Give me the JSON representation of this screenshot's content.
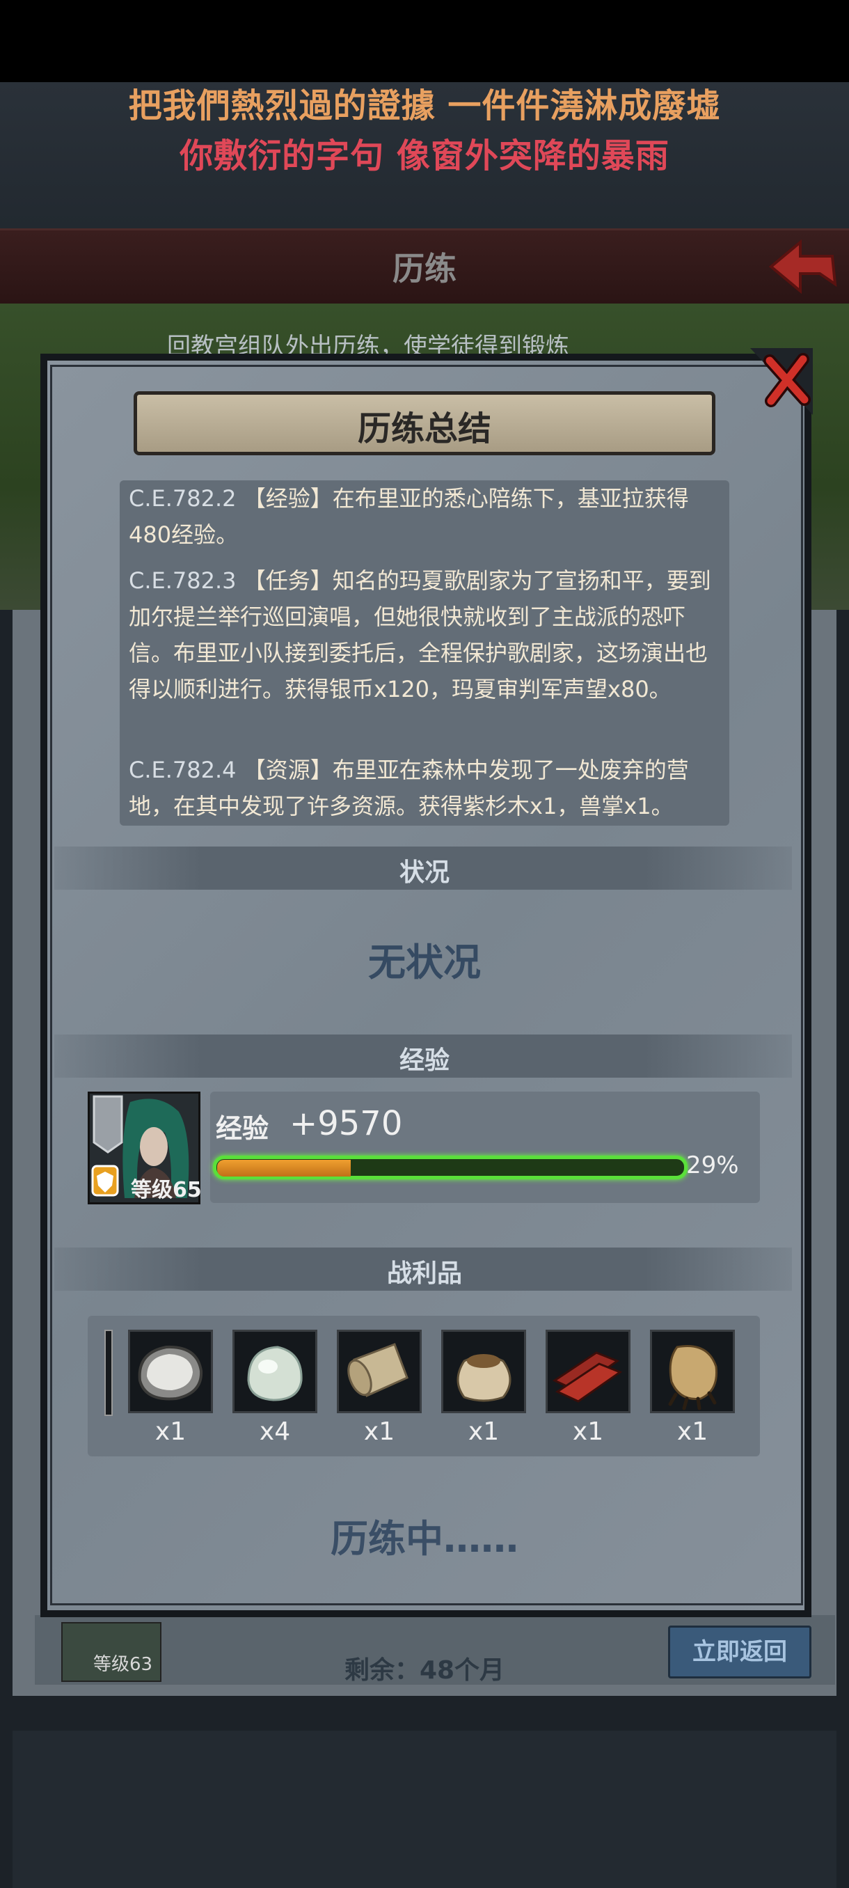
{
  "lyrics": {
    "line1": "把我們熱烈過的證據 一件件澆淋成廢墟",
    "line2": "你敷衍的字句 像窗外突降的暴雨"
  },
  "header": {
    "title": "历练"
  },
  "background": {
    "scene_text": "回教宫组队外出历练，使学徒得到锻炼",
    "level": "等级63",
    "remaining": "剩余：48个月",
    "return_button": "立即返回"
  },
  "dialog": {
    "title": "历练总结",
    "log": [
      {
        "date": "C.E.782.2",
        "text": "【经验】在布里亚的悉心陪练下，基亚拉获得480经验。"
      },
      {
        "date": "C.E.782.3",
        "text": "【任务】知名的玛夏歌剧家为了宣扬和平，要到加尔提兰举行巡回演唱，但她很快就收到了主战派的恐吓信。布里亚小队接到委托后，全程保护歌剧家，这场演出也得以顺利进行。获得银币x120，玛夏审判军声望x80。"
      },
      {
        "date": "C.E.782.4",
        "text": "【资源】布里亚在森林中发现了一处废弃的营地，在其中发现了许多资源。获得紫杉木x1，兽掌x1。"
      }
    ],
    "status_section": "状况",
    "status_value": "无状况",
    "exp_section": "经验",
    "character": {
      "level": "等级65"
    },
    "exp_label": "经验",
    "exp_value": "+9570",
    "exp_progress": 0.29,
    "exp_percent": "29%",
    "loot_section": "战利品",
    "loot": [
      {
        "icon": "oyster-icon",
        "count": "x1"
      },
      {
        "icon": "pearl-stone-icon",
        "count": "x4"
      },
      {
        "icon": "scroll-icon",
        "count": "x1"
      },
      {
        "icon": "sack-icon",
        "count": "x1"
      },
      {
        "icon": "wood-planks-icon",
        "count": "x1"
      },
      {
        "icon": "beast-paw-icon",
        "count": "x1"
      }
    ],
    "training_status": "历练中……"
  }
}
